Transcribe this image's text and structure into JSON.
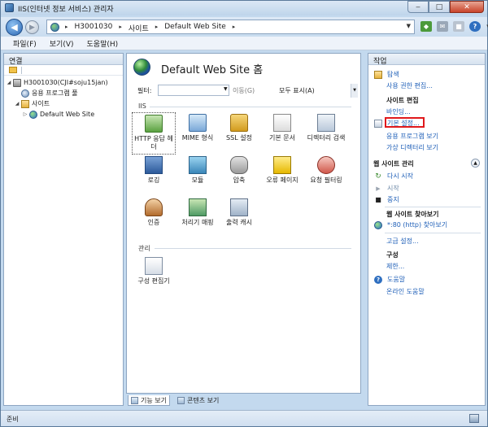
{
  "window": {
    "title": "IIS(인터넷 정보 서비스) 관리자",
    "min": "‒",
    "max": "□",
    "close": "✕"
  },
  "address": {
    "crumbs": [
      "H3001030",
      "사이트",
      "Default Web Site"
    ],
    "sep": "▸"
  },
  "menu": [
    "파일(F)",
    "보기(V)",
    "도움말(H)"
  ],
  "connections": {
    "title": "연결",
    "tree": [
      {
        "label": "H3001030(CJI#soju15jan)",
        "icon": "server-icon",
        "level": 0,
        "toggle": "◢"
      },
      {
        "label": "응용 프로그램 풀",
        "icon": "app-pool-icon",
        "level": 1,
        "toggle": ""
      },
      {
        "label": "사이트",
        "icon": "folder-icon",
        "level": 1,
        "toggle": "◢"
      },
      {
        "label": "Default Web Site",
        "icon": "globe-icon",
        "level": 2,
        "toggle": "▷"
      }
    ]
  },
  "center": {
    "title": "Default Web Site 홈",
    "filter": {
      "label": "필터:",
      "go": "이동(G)",
      "show_all": "모두 표시(A)"
    },
    "group_iis": "IIS",
    "group_manage": "관리",
    "features_row1": [
      {
        "label": "HTTP 응답 헤더",
        "icon": "http-headers-icon"
      },
      {
        "label": "MIME 형식",
        "icon": "mime-types-icon"
      },
      {
        "label": "SSL 설정",
        "icon": "ssl-lock-icon"
      },
      {
        "label": "기본 문서",
        "icon": "default-document-icon"
      },
      {
        "label": "디렉터리 검색",
        "icon": "directory-browsing-icon"
      }
    ],
    "features_row2": [
      {
        "label": "로깅",
        "icon": "logging-icon"
      },
      {
        "label": "모듈",
        "icon": "modules-icon"
      },
      {
        "label": "압축",
        "icon": "compression-icon"
      },
      {
        "label": "오류 페이지",
        "icon": "error-pages-icon"
      },
      {
        "label": "요청 필터링",
        "icon": "request-filtering-icon"
      }
    ],
    "features_row3": [
      {
        "label": "인증",
        "icon": "authentication-icon"
      },
      {
        "label": "처리기 매핑",
        "icon": "handler-mappings-icon"
      },
      {
        "label": "출력 캐시",
        "icon": "output-cache-icon"
      }
    ],
    "features_manage": [
      {
        "label": "구성 편집기",
        "icon": "configuration-editor-icon"
      }
    ]
  },
  "actions": {
    "title": "작업",
    "explore": "탐색",
    "edit_permissions": "사용 권한 편집...",
    "edit_site_head": "사이트 편집",
    "bindings": "바인딩...",
    "basic_settings": "기본 설정...",
    "view_apps": "응용 프로그램 보기",
    "view_vdirs": "가상 디렉터리 보기",
    "manage_site_head": "웹 사이트 관리",
    "restart": "다시 시작",
    "start": "시작",
    "stop": "중지",
    "browse_head": "웹 사이트 찾아보기",
    "browse_80": "*:80 (http) 찾아보기",
    "advanced": "고급 설정...",
    "config_head": "구성",
    "limits": "제한...",
    "help": "도움말",
    "online_help": "온라인 도움말"
  },
  "view_tabs": {
    "features": "기능 보기",
    "content": "콘텐츠 보기"
  },
  "status": "준비",
  "colors": {
    "link": "#2060b8",
    "highlight": "#e0191c"
  }
}
